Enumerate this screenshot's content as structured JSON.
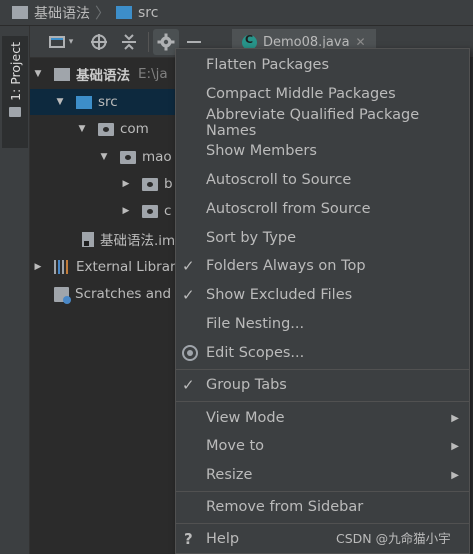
{
  "breadcrumb": {
    "project": "基础语法",
    "folder": "src"
  },
  "tool_window": {
    "tab_label": "1: Project"
  },
  "toolbar": {
    "caret": "▾",
    "editor_tab": "Demo08.java",
    "editor_tab_close": "✕"
  },
  "tree": {
    "rows": [
      {
        "arrow": "▼",
        "label": "基础语法",
        "hint": "E:\\ja"
      },
      {
        "arrow": "▼",
        "label": "src"
      },
      {
        "arrow": "▼",
        "label": "com"
      },
      {
        "arrow": "▼",
        "label": "mao"
      },
      {
        "arrow": "▶",
        "label": "b"
      },
      {
        "arrow": "▶",
        "label": "c"
      },
      {
        "label": "基础语法.im"
      },
      {
        "arrow": "▶",
        "label": "External Librari"
      },
      {
        "label": "Scratches and C"
      }
    ]
  },
  "menu": {
    "items": [
      {
        "label": "Flatten Packages"
      },
      {
        "label": "Compact Middle Packages"
      },
      {
        "label": "Abbreviate Qualified Package Names"
      },
      {
        "label": "Show Members"
      },
      {
        "label": "Autoscroll to Source"
      },
      {
        "label": "Autoscroll from Source"
      },
      {
        "label": "Sort by Type"
      },
      {
        "label": "Folders Always on Top",
        "checked": "✓"
      },
      {
        "label": "Show Excluded Files",
        "checked": "✓"
      },
      {
        "label": "File Nesting..."
      },
      {
        "label": "Edit Scopes..."
      },
      {
        "label": "Group Tabs",
        "checked": "✓"
      },
      {
        "label": "View Mode",
        "submenu": "▶"
      },
      {
        "label": "Move to",
        "submenu": "▶"
      },
      {
        "label": "Resize",
        "submenu": "▶"
      },
      {
        "label": "Remove from Sidebar"
      },
      {
        "label": "Help",
        "icon": "?"
      }
    ]
  },
  "watermark": "CSDN @九命猫小宇",
  "colors": {
    "background": "#2b2b2b",
    "panel": "#3c3f41",
    "selection": "#0d293e",
    "accent": "#4a88c7",
    "folder_blue": "#3d8ec9"
  }
}
